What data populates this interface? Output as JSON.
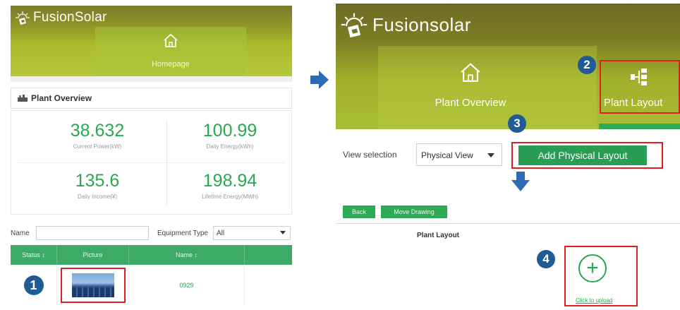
{
  "left": {
    "brand": "FusionSolar",
    "home_tab": "Homepage",
    "overview_title": "Plant Overview",
    "stats": [
      {
        "value": "38.632",
        "label": "Current Power(kW)"
      },
      {
        "value": "100.99",
        "label": "Daily Energy(kWh)"
      },
      {
        "value": "135.6",
        "label": "Daily Income(¥)"
      },
      {
        "value": "198.94",
        "label": "Lifetime Energy(MWh)"
      }
    ],
    "filter": {
      "name_label": "Name",
      "name_value": "",
      "equipment_label": "Equipment Type",
      "equipment_value": "All"
    },
    "table": {
      "headers": [
        "Status ↕",
        "Picture",
        "Name ↕"
      ],
      "row": {
        "name": "0929"
      }
    },
    "step_badge": "1"
  },
  "right": {
    "brand": "Fusionsolar",
    "tab_overview": "Plant Overview",
    "tab_layout": "Plant Layout",
    "step2": "2",
    "step3": "3",
    "step4": "4",
    "view_label": "View selection",
    "view_value": "Physical View",
    "add_button": "Add Physical Layout",
    "back_button": "Back",
    "move_button": "Move Drawing",
    "layout_title": "Plant Layout",
    "upload_label": "Click to upload"
  },
  "colors": {
    "accent_green": "#2aa84f",
    "header_olive": "#8f9528",
    "highlight_red": "#e02020",
    "badge_blue": "#1f5b94"
  }
}
